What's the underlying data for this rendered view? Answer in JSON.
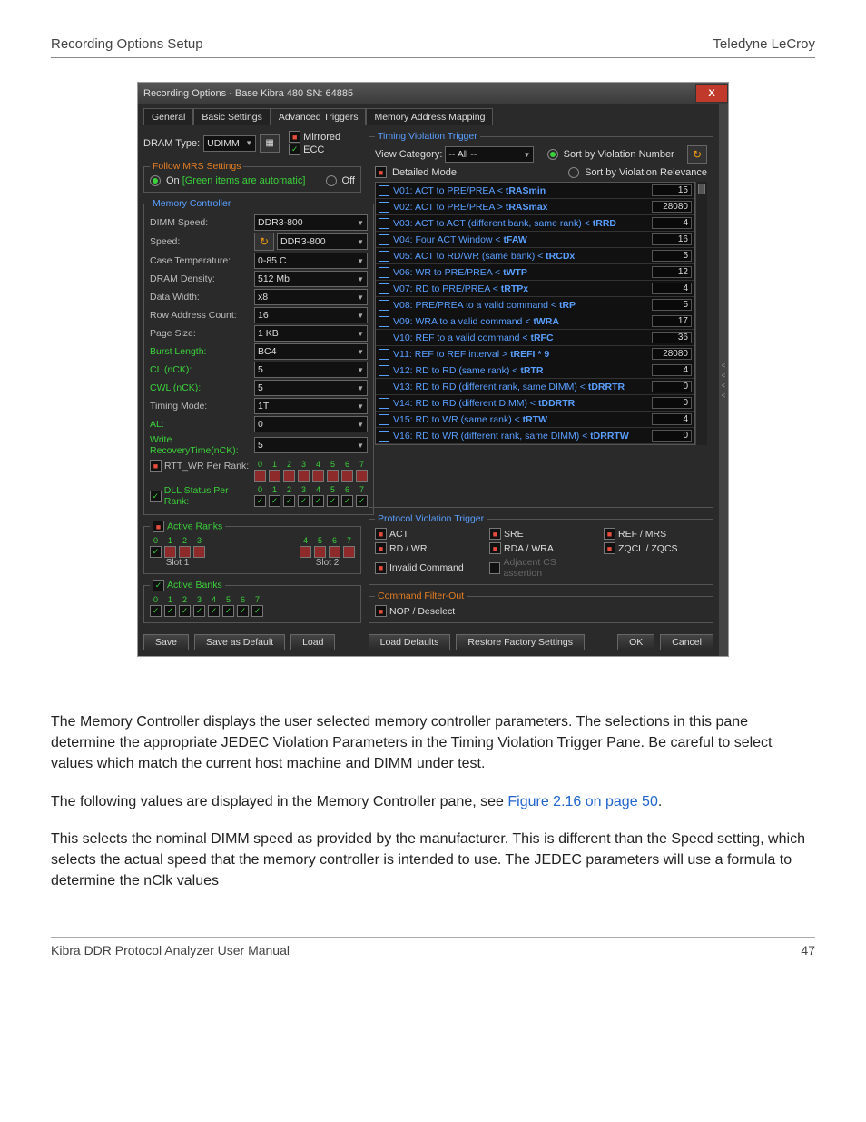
{
  "page": {
    "header_left": "Recording Options Setup",
    "header_right": "Teledyne LeCroy",
    "footer_left": "Kibra DDR Protocol Analyzer User Manual",
    "footer_right": "47"
  },
  "body_paragraphs": [
    "The Memory Controller displays the user selected memory controller parameters. The selections in this pane determine the appropriate JEDEC Violation Parameters in the Timing Violation Trigger Pane. Be careful to select values which match the current host machine and DIMM under test.",
    "The following values are displayed in the Memory Controller pane, see ",
    "Figure 2.16 on page 50",
    ".",
    "This selects the nominal DIMM speed as provided by the manufacturer. This is different than the Speed setting, which selects the actual speed that the memory controller is intended to use. The JEDEC parameters will use a formula to determine the nClk values"
  ],
  "dialog": {
    "title": "Recording Options - Base Kibra 480 SN: 64885",
    "tabs": [
      "General",
      "Basic Settings",
      "Advanced Triggers",
      "Memory Address Mapping"
    ],
    "active_tab": 2,
    "dram_type_label": "DRAM Type:",
    "dram_type_value": "UDIMM",
    "mirrored_label": "Mirrored",
    "ecc_label": "ECC",
    "follow_mrs": {
      "legend": "Follow MRS Settings",
      "on_label": "On",
      "hint": "[Green items are automatic]",
      "off_label": "Off"
    },
    "memory_controller": {
      "legend": "Memory Controller",
      "rows": [
        {
          "label": "DIMM Speed:",
          "value": "DDR3-800",
          "green": false
        },
        {
          "label": "Speed:",
          "value": "DDR3-800",
          "green": false,
          "refresh": true
        },
        {
          "label": "Case Temperature:",
          "value": "0-85 C",
          "green": false
        },
        {
          "label": "DRAM Density:",
          "value": "512 Mb",
          "green": false
        },
        {
          "label": "Data Width:",
          "value": "x8",
          "green": false
        },
        {
          "label": "Row Address Count:",
          "value": "16",
          "green": false
        },
        {
          "label": "Page Size:",
          "value": "1 KB",
          "green": false
        },
        {
          "label": "Burst Length:",
          "value": "BC4",
          "green": true
        },
        {
          "label": "CL (nCK):",
          "value": "5",
          "green": true
        },
        {
          "label": "CWL (nCK):",
          "value": "5",
          "green": true
        },
        {
          "label": "Timing Mode:",
          "value": "1T",
          "green": false
        },
        {
          "label": "AL:",
          "value": "0",
          "green": true
        },
        {
          "label": "Write RecoveryTime(nCK):",
          "value": "5",
          "green": true
        }
      ],
      "rtt_wr_label": "RTT_WR Per Rank:",
      "dll_status_label": "DLL Status Per Rank:",
      "rank_numbers": [
        "0",
        "1",
        "2",
        "3",
        "4",
        "5",
        "6",
        "7"
      ]
    },
    "active_ranks": {
      "legend": "Active Ranks",
      "numbers": [
        "0",
        "1",
        "2",
        "3",
        "4",
        "5",
        "6",
        "7"
      ],
      "slot1": "Slot 1",
      "slot2": "Slot 2"
    },
    "active_banks": {
      "legend": "Active Banks",
      "numbers": [
        "0",
        "1",
        "2",
        "3",
        "4",
        "5",
        "6",
        "7"
      ]
    },
    "timing_violation": {
      "legend": "Timing Violation Trigger",
      "view_category_label": "View Category:",
      "view_category_value": "-- All --",
      "sort_num": "Sort by Violation Number",
      "sort_rel": "Sort by Violation Relevance",
      "detailed_mode": "Detailed Mode",
      "violations": [
        {
          "label": "V01: ACT to PRE/PREA < tRASmin",
          "val": "15"
        },
        {
          "label": "V02: ACT to PRE/PREA > tRASmax",
          "val": "28080"
        },
        {
          "label": "V03: ACT to ACT (different bank, same rank) < tRRD",
          "val": "4"
        },
        {
          "label": "V04: Four ACT Window < tFAW",
          "val": "16"
        },
        {
          "label": "V05: ACT to RD/WR (same bank) < tRCDx",
          "val": "5"
        },
        {
          "label": "V06: WR to PRE/PREA < tWTP",
          "val": "12"
        },
        {
          "label": "V07: RD to PRE/PREA < tRTPx",
          "val": "4"
        },
        {
          "label": "V08: PRE/PREA to a valid command < tRP",
          "val": "5"
        },
        {
          "label": "V09: WRA to a valid command < tWRA",
          "val": "17"
        },
        {
          "label": "V10: REF to a valid command < tRFC",
          "val": "36"
        },
        {
          "label": "V11: REF to REF interval > tREFI * 9",
          "val": "28080"
        },
        {
          "label": "V12: RD to RD (same rank) < tRTR",
          "val": "4"
        },
        {
          "label": "V13: RD to RD (different rank, same DIMM) < tDRRTR",
          "val": "0"
        },
        {
          "label": "V14: RD to RD (different DIMM) < tDDRTR",
          "val": "0"
        },
        {
          "label": "V15: RD to WR (same rank) < tRTW",
          "val": "4"
        },
        {
          "label": "V16: RD to WR (different rank, same DIMM) < tDRRTW",
          "val": "0"
        }
      ]
    },
    "protocol_violation": {
      "legend": "Protocol Violation Trigger",
      "items": [
        {
          "label": "ACT"
        },
        {
          "label": "SRE"
        },
        {
          "label": "REF / MRS"
        },
        {
          "label": "RD / WR"
        },
        {
          "label": "RDA / WRA"
        },
        {
          "label": "ZQCL / ZQCS"
        },
        {
          "label": "Invalid Command"
        },
        {
          "label": "Adjacent CS assertion",
          "disabled": true
        },
        {
          "label": ""
        }
      ]
    },
    "command_filter": {
      "legend": "Command Filter-Out",
      "nop": "NOP / Deselect"
    },
    "buttons": {
      "save": "Save",
      "save_default": "Save as Default",
      "load": "Load",
      "load_defaults": "Load Defaults",
      "restore": "Restore Factory Settings",
      "ok": "OK",
      "cancel": "Cancel"
    }
  }
}
